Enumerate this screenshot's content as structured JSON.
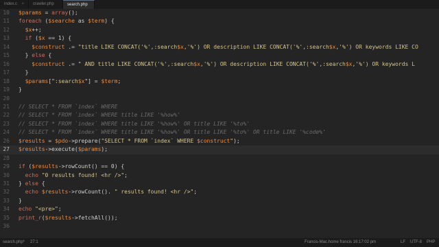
{
  "tabs": [
    {
      "label": "index.c",
      "close": "×",
      "active": false
    },
    {
      "label": "crawler.php",
      "close": "",
      "active": false
    },
    {
      "label": "search.php",
      "close": "",
      "active": true
    }
  ],
  "lines": [
    {
      "n": "10",
      "parts": [
        [
          "v",
          "$params"
        ],
        [
          "p",
          " = "
        ],
        [
          "k",
          "array"
        ],
        [
          "p",
          "();"
        ]
      ]
    },
    {
      "n": "11",
      "parts": [
        [
          "k",
          "foreach"
        ],
        [
          "p",
          " ("
        ],
        [
          "v",
          "$searche"
        ],
        [
          "p",
          " as "
        ],
        [
          "v",
          "$term"
        ],
        [
          "p",
          ") {"
        ]
      ]
    },
    {
      "n": "12",
      "parts": [
        [
          "p",
          "  "
        ],
        [
          "v",
          "$x"
        ],
        [
          "p",
          "++;"
        ]
      ]
    },
    {
      "n": "13",
      "parts": [
        [
          "p",
          "  "
        ],
        [
          "k",
          "if"
        ],
        [
          "p",
          " ("
        ],
        [
          "v",
          "$x"
        ],
        [
          "p",
          " == 1) {"
        ]
      ]
    },
    {
      "n": "14",
      "parts": [
        [
          "p",
          "    "
        ],
        [
          "v",
          "$construct"
        ],
        [
          "p",
          " .= "
        ],
        [
          "s",
          "\"title LIKE CONCAT('%',:search"
        ],
        [
          "v",
          "$x"
        ],
        [
          "s",
          ",'%') OR description LIKE CONCAT('%',:search"
        ],
        [
          "v",
          "$x"
        ],
        [
          "s",
          ",'%') OR keywords LIKE CO"
        ]
      ]
    },
    {
      "n": "15",
      "parts": [
        [
          "p",
          "  } "
        ],
        [
          "k",
          "else"
        ],
        [
          "p",
          " {"
        ]
      ]
    },
    {
      "n": "16",
      "parts": [
        [
          "p",
          "    "
        ],
        [
          "v",
          "$construct"
        ],
        [
          "p",
          " .= "
        ],
        [
          "s",
          "\" AND title LIKE CONCAT('%',:search"
        ],
        [
          "v",
          "$x"
        ],
        [
          "s",
          ",'%') OR description LIKE CONCAT('%',:search"
        ],
        [
          "v",
          "$x"
        ],
        [
          "s",
          ",'%') OR keywords L"
        ]
      ]
    },
    {
      "n": "17",
      "parts": [
        [
          "p",
          "  }"
        ]
      ]
    },
    {
      "n": "18",
      "parts": [
        [
          "p",
          "  "
        ],
        [
          "v",
          "$params"
        ],
        [
          "p",
          "[\""
        ],
        [
          "s",
          ":search"
        ],
        [
          "v",
          "$x"
        ],
        [
          "p",
          "\"] = "
        ],
        [
          "v",
          "$term"
        ],
        [
          "p",
          ";"
        ]
      ]
    },
    {
      "n": "19",
      "parts": [
        [
          "p",
          "}"
        ]
      ]
    },
    {
      "n": "20",
      "parts": []
    },
    {
      "n": "21",
      "parts": [
        [
          "c",
          "// SELECT * FROM `index` WHERE"
        ]
      ]
    },
    {
      "n": "22",
      "parts": [
        [
          "c",
          "// SELECT * FROM `index` WHERE title LIKE '%how%'"
        ]
      ]
    },
    {
      "n": "23",
      "parts": [
        [
          "c",
          "// SELECT * FROM `index` WHERE title LIKE '%how%' OR title LIKE '%to%'"
        ]
      ]
    },
    {
      "n": "24",
      "parts": [
        [
          "c",
          "// SELECT * FROM `index` WHERE title LIKE '%how%' OR title LIKE '%to%' OR title LIKE '%code%'"
        ]
      ]
    },
    {
      "n": "26",
      "parts": [
        [
          "v",
          "$results"
        ],
        [
          "p",
          " = "
        ],
        [
          "v",
          "$pdo"
        ],
        [
          "p",
          "->prepare("
        ],
        [
          "s",
          "\"SELECT * FROM `index` WHERE "
        ],
        [
          "v",
          "$construct"
        ],
        [
          "s",
          "\""
        ],
        [
          "p",
          ");"
        ]
      ]
    },
    {
      "n": "27",
      "cur": true,
      "parts": [
        [
          "v",
          "$results"
        ],
        [
          "p",
          "->execute("
        ],
        [
          "v",
          "$params"
        ],
        [
          "p",
          ");"
        ]
      ]
    },
    {
      "n": "28",
      "parts": []
    },
    {
      "n": "29",
      "parts": [
        [
          "k",
          "if"
        ],
        [
          "p",
          " ("
        ],
        [
          "v",
          "$results"
        ],
        [
          "p",
          "->rowCount() == 0) {"
        ]
      ]
    },
    {
      "n": "30",
      "parts": [
        [
          "p",
          "  "
        ],
        [
          "k",
          "echo"
        ],
        [
          "p",
          " "
        ],
        [
          "s",
          "\"0 results found! <hr />\""
        ],
        [
          "p",
          ";"
        ]
      ]
    },
    {
      "n": "31",
      "parts": [
        [
          "p",
          "} "
        ],
        [
          "k",
          "else"
        ],
        [
          "p",
          " {"
        ]
      ]
    },
    {
      "n": "32",
      "parts": [
        [
          "p",
          "  "
        ],
        [
          "k",
          "echo"
        ],
        [
          "p",
          " "
        ],
        [
          "v",
          "$results"
        ],
        [
          "p",
          "->rowCount(). "
        ],
        [
          "s",
          "\" results found! <hr />\""
        ],
        [
          "p",
          ";"
        ]
      ]
    },
    {
      "n": "33",
      "parts": [
        [
          "p",
          "}"
        ]
      ]
    },
    {
      "n": "34",
      "parts": [
        [
          "k",
          "echo"
        ],
        [
          "p",
          " "
        ],
        [
          "s",
          "\"<pre>\""
        ],
        [
          "p",
          ";"
        ]
      ]
    },
    {
      "n": "35",
      "parts": [
        [
          "k",
          "print_r"
        ],
        [
          "p",
          "("
        ],
        [
          "v",
          "$results"
        ],
        [
          "p",
          "->fetchAll());"
        ]
      ]
    },
    {
      "n": "36",
      "parts": []
    }
  ],
  "status": {
    "file": "search.php*",
    "position": "27:1",
    "host": "Francis-Mac.home francis 16:17:02 pm",
    "line_ending": "LF",
    "encoding": "UTF-8",
    "language": "PHP"
  }
}
